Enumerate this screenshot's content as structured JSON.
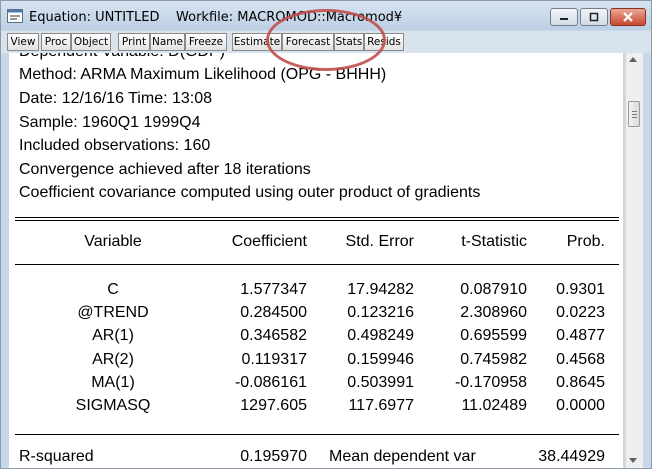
{
  "window": {
    "title": "Equation: UNTITLED    Workfile: MACROMOD::Macromod¥"
  },
  "toolbar": {
    "buttons": [
      "View",
      "Proc",
      "Object",
      "Print",
      "Name",
      "Freeze",
      "Estimate",
      "Forecast",
      "Stats",
      "Resids"
    ]
  },
  "header_lines": {
    "dependent": "Dependent Variable: D(GDP)",
    "method": "Method: ARMA Maximum Likelihood (OPG - BHHH)",
    "date": "Date: 12/16/16   Time: 13:08",
    "sample": "Sample: 1960Q1 1999Q4",
    "obs": "Included observations: 160",
    "convergence": "Convergence achieved after 18 iterations",
    "covariance": "Coefficient covariance computed using outer product of gradients"
  },
  "table": {
    "columns": [
      "Variable",
      "Coefficient",
      "Std. Error",
      "t-Statistic",
      "Prob."
    ],
    "rows": [
      {
        "variable": "C",
        "coefficient": "1.577347",
        "std_error": "17.94282",
        "t_stat": "0.087910",
        "prob": "0.9301"
      },
      {
        "variable": "@TREND",
        "coefficient": "0.284500",
        "std_error": "0.123216",
        "t_stat": "2.308960",
        "prob": "0.0223"
      },
      {
        "variable": "AR(1)",
        "coefficient": "0.346582",
        "std_error": "0.498249",
        "t_stat": "0.695599",
        "prob": "0.4877"
      },
      {
        "variable": "AR(2)",
        "coefficient": "0.119317",
        "std_error": "0.159946",
        "t_stat": "0.745982",
        "prob": "0.4568"
      },
      {
        "variable": "MA(1)",
        "coefficient": "-0.086161",
        "std_error": "0.503991",
        "t_stat": "-0.170958",
        "prob": "0.8645"
      },
      {
        "variable": "SIGMASQ",
        "coefficient": "1297.605",
        "std_error": "117.6977",
        "t_stat": "11.02489",
        "prob": "0.0000"
      }
    ]
  },
  "stats": {
    "rsquared_label": "R-squared",
    "rsquared_value": "0.195970",
    "mean_dep_label": "Mean dependent var",
    "mean_dep_value": "38.44929"
  },
  "colors": {
    "annotation": "#c0504d"
  },
  "icons": {
    "app": "equation-app-icon",
    "minimize": "minimize-icon",
    "maximize": "maximize-icon",
    "close": "close-icon"
  }
}
